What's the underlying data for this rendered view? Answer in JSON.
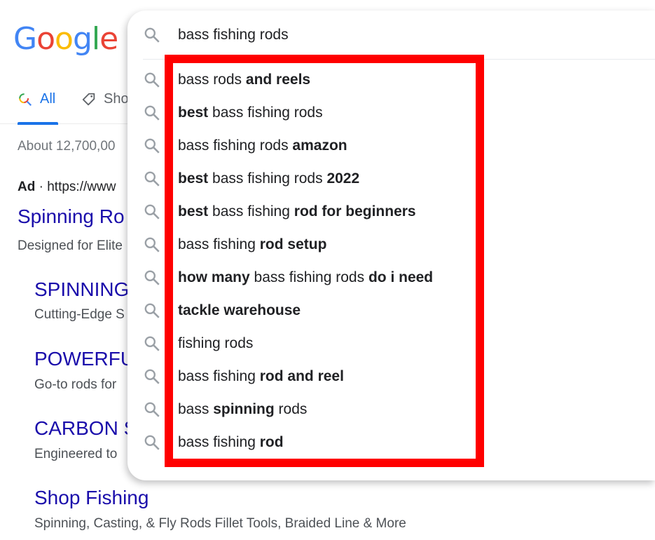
{
  "logo": "Google",
  "colors": {
    "accent": "#1a73e8",
    "link": "#1a0dab",
    "highlight_box": "#ff0000"
  },
  "tabs": [
    {
      "label": "All",
      "icon": "search-icon",
      "active": true
    },
    {
      "label": "Sho",
      "icon": "tag-icon"
    }
  ],
  "stats": "About 12,700,00",
  "ad": {
    "label": "Ad",
    "url": "https://www"
  },
  "results": [
    {
      "title": "Spinning Ro",
      "desc": "Designed for Elite"
    },
    {
      "title": "SPINNING",
      "desc": "Cutting-Edge S"
    },
    {
      "title": "POWERFU",
      "desc": "Go-to rods for"
    },
    {
      "title": "CARBON S",
      "desc": "Engineered to"
    },
    {
      "title": "Shop Fishing",
      "desc": "Spinning, Casting, & Fly Rods Fillet Tools, Braided Line & More"
    }
  ],
  "search": {
    "query": "bass fishing rods"
  },
  "suggestions": [
    [
      [
        "bass rods ",
        0
      ],
      [
        "and reels",
        1
      ]
    ],
    [
      [
        "best",
        1
      ],
      [
        " bass fishing rods",
        0
      ]
    ],
    [
      [
        "bass fishing rods ",
        0
      ],
      [
        "amazon",
        1
      ]
    ],
    [
      [
        "best",
        1
      ],
      [
        " bass fishing rods ",
        0
      ],
      [
        "2022",
        1
      ]
    ],
    [
      [
        "best",
        1
      ],
      [
        " bass fishing ",
        0
      ],
      [
        "rod for beginners",
        1
      ]
    ],
    [
      [
        "bass fishing ",
        0
      ],
      [
        "rod setup",
        1
      ]
    ],
    [
      [
        "how many",
        1
      ],
      [
        " bass fishing rods ",
        0
      ],
      [
        "do i need",
        1
      ]
    ],
    [
      [
        "tackle warehouse",
        1
      ]
    ],
    [
      [
        "fishing rods",
        0
      ]
    ],
    [
      [
        "bass fishing ",
        0
      ],
      [
        "rod and reel",
        1
      ]
    ],
    [
      [
        "bass ",
        0
      ],
      [
        "spinning",
        1
      ],
      [
        " rods",
        0
      ]
    ],
    [
      [
        "bass fishing ",
        0
      ],
      [
        "rod",
        1
      ]
    ]
  ]
}
